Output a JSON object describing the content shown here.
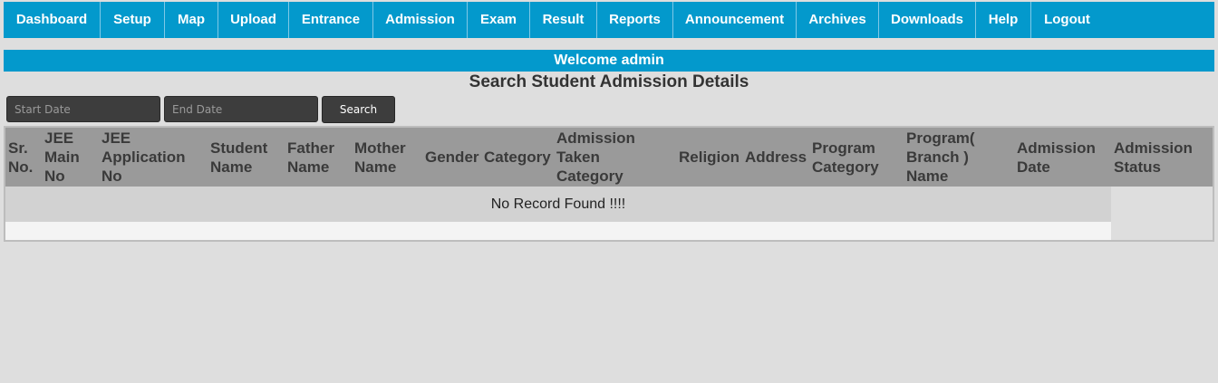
{
  "nav": {
    "items": [
      {
        "label": "Dashboard",
        "name": "nav-dashboard"
      },
      {
        "label": "Setup",
        "name": "nav-setup"
      },
      {
        "label": "Map",
        "name": "nav-map"
      },
      {
        "label": "Upload",
        "name": "nav-upload"
      },
      {
        "label": "Entrance",
        "name": "nav-entrance"
      },
      {
        "label": "Admission",
        "name": "nav-admission"
      },
      {
        "label": "Exam",
        "name": "nav-exam"
      },
      {
        "label": "Result",
        "name": "nav-result"
      },
      {
        "label": "Reports",
        "name": "nav-reports"
      },
      {
        "label": "Announcement",
        "name": "nav-announcement"
      },
      {
        "label": "Archives",
        "name": "nav-archives"
      },
      {
        "label": "Downloads",
        "name": "nav-downloads"
      },
      {
        "label": "Help",
        "name": "nav-help"
      },
      {
        "label": "Logout",
        "name": "nav-logout"
      }
    ]
  },
  "welcome": "Welcome admin",
  "page_title": "Search Student Admission Details",
  "search": {
    "start_date_placeholder": "Start Date",
    "end_date_placeholder": "End Date",
    "start_date_value": "",
    "end_date_value": "",
    "button_label": "Search"
  },
  "table": {
    "columns": [
      "Sr.\nNo.",
      "JEE\nMain\nNo",
      "JEE\nApplication\nNo",
      "Student\nName",
      "Father\nName",
      "Mother\nName",
      "Gender",
      "Category",
      "Admission\nTaken\nCategory",
      "Religion",
      "Address",
      "Program\nCategory",
      "Program(\nBranch )\nName",
      "Admission\nDate",
      "Admission\nStatus"
    ],
    "empty_message": "No Record Found !!!!"
  },
  "colors": {
    "primary": "#0399cc",
    "header_bg": "#9a9a9a",
    "input_bg": "#3d3d3d"
  }
}
